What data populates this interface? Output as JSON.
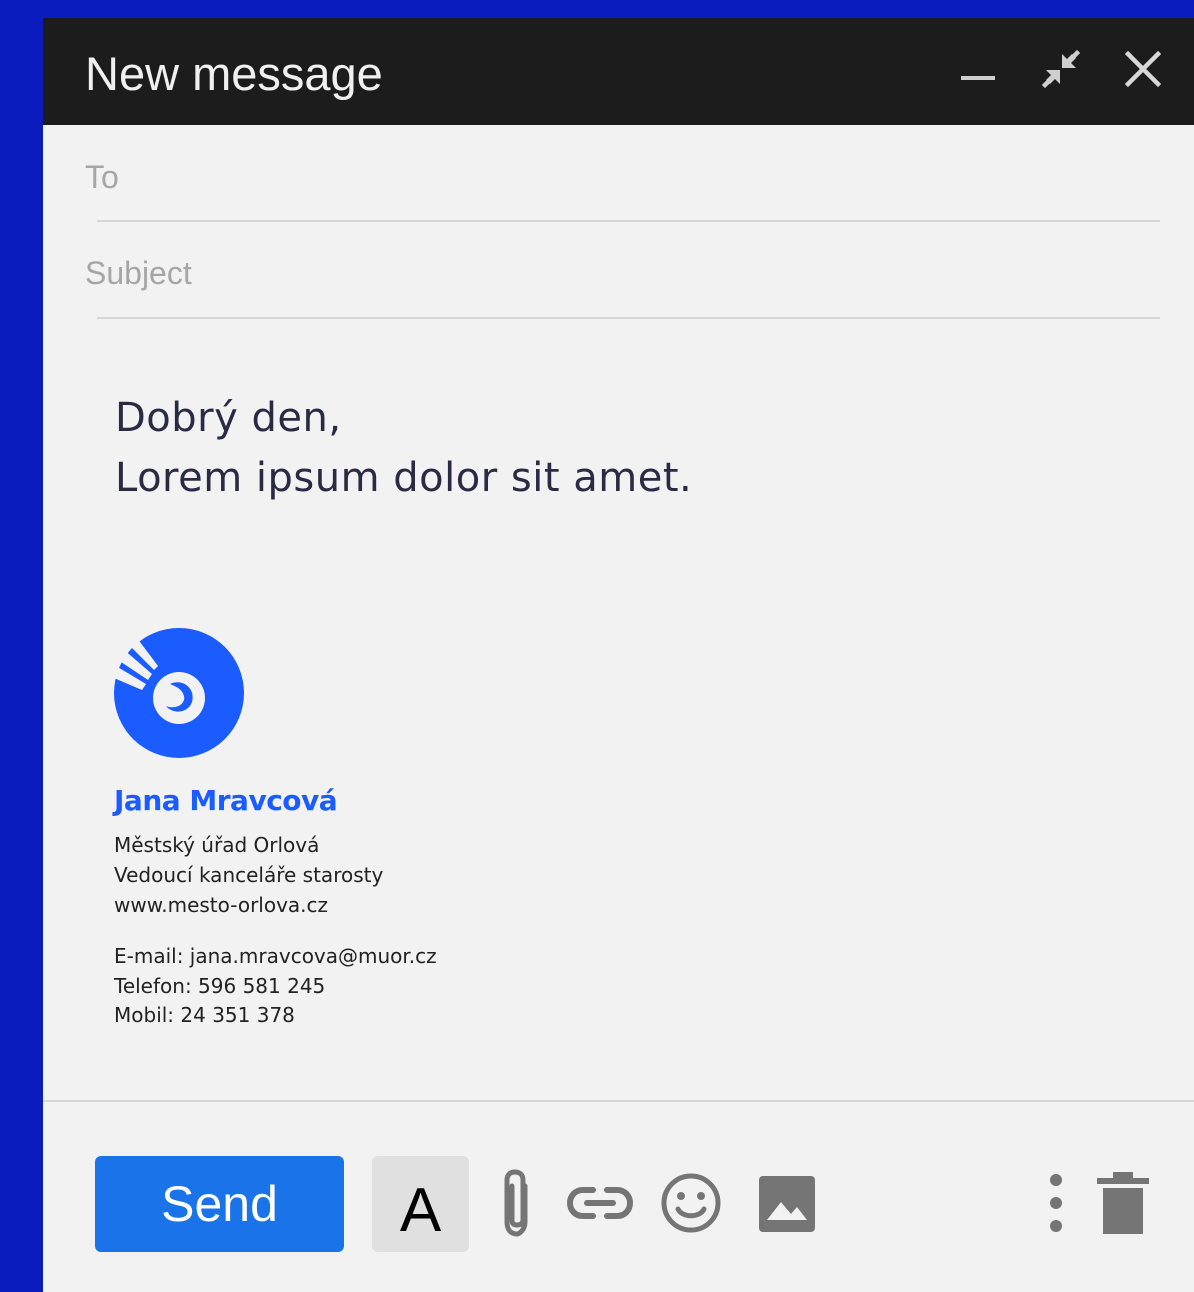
{
  "window": {
    "title": "New message",
    "controls": {
      "minimize": "minimize-icon",
      "exit_fullscreen": "exit-fullscreen-icon",
      "close": "close-icon"
    }
  },
  "compose": {
    "to_placeholder": "To",
    "subject_placeholder": "Subject",
    "body_lines": [
      "Dobrý den,",
      "Lorem ipsum dolor sit amet."
    ]
  },
  "signature": {
    "logo": "orlova-city-logo",
    "name": "Jana Mravcová",
    "lines": [
      "Městský úřad Orlová",
      "Vedoucí kanceláře starosty",
      "www.mesto-orlova.cz"
    ],
    "contact": [
      "E-mail: jana.mravcova@muor.cz",
      "Telefon: 596 581 245",
      "Mobil: 24 351 378"
    ]
  },
  "toolbar": {
    "send_label": "Send",
    "format_label": "A",
    "icons": [
      "attach-icon",
      "link-icon",
      "emoji-icon",
      "photo-icon",
      "more-options-icon",
      "trash-icon"
    ]
  },
  "colors": {
    "background": "#0b1cbf",
    "titlebar": "#1c1c1c",
    "compose_bg": "#f2f2f2",
    "accent_send": "#1a73e8",
    "signature_blue": "#1a5cff",
    "icon_gray": "#757575"
  }
}
